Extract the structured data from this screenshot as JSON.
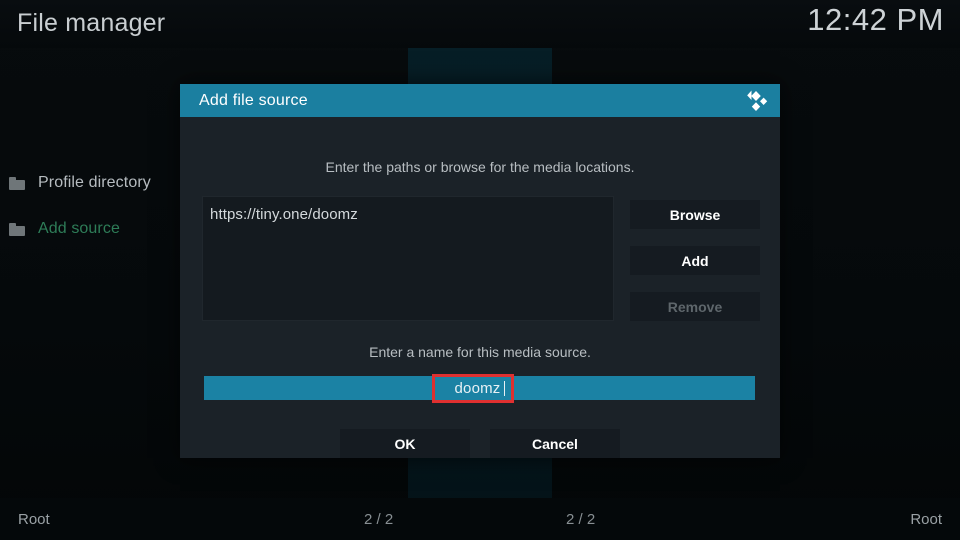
{
  "header": {
    "title": "File manager",
    "clock": "12:42 PM"
  },
  "sidebar": {
    "items": [
      {
        "label": "Profile directory",
        "icon": "folder-icon",
        "state": "normal"
      },
      {
        "label": "Add source",
        "icon": "folder-icon",
        "state": "selected"
      }
    ]
  },
  "footer": {
    "left_label": "Root",
    "left_count": "2 / 2",
    "right_count": "2 / 2",
    "right_label": "Root"
  },
  "dialog": {
    "title": "Add file source",
    "logo_icon": "kodi-logo-icon",
    "paths_hint": "Enter the paths or browse for the media locations.",
    "paths": [
      "https://tiny.one/doomz"
    ],
    "buttons": {
      "browse": "Browse",
      "add": "Add",
      "remove": "Remove",
      "ok": "OK",
      "cancel": "Cancel"
    },
    "name_hint": "Enter a name for this media source.",
    "name_value": "doomz",
    "accent_color": "#1b7fa0",
    "field_color": "#1b82a4",
    "highlight_color": "#e03030"
  }
}
